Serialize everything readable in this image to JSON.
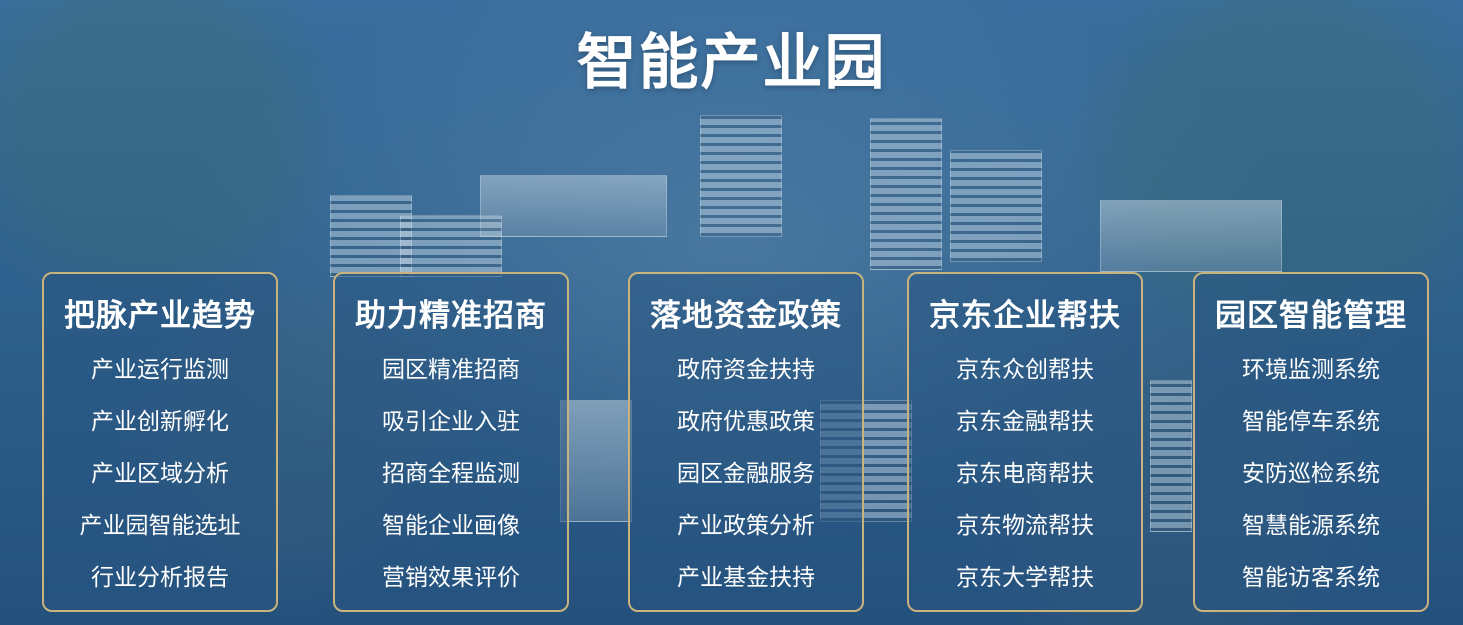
{
  "page": {
    "title": "智能产业园"
  },
  "theme": {
    "background": "#2f5f8f",
    "card_border": "#c9b27c",
    "text": "#ffffff"
  },
  "cards": [
    {
      "title": "把脉产业趋势",
      "items": [
        "产业运行监测",
        "产业创新孵化",
        "产业区域分析",
        "产业园智能选址",
        "行业分析报告"
      ]
    },
    {
      "title": "助力精准招商",
      "items": [
        "园区精准招商",
        "吸引企业入驻",
        "招商全程监测",
        "智能企业画像",
        "营销效果评价"
      ]
    },
    {
      "title": "落地资金政策",
      "items": [
        "政府资金扶持",
        "政府优惠政策",
        "园区金融服务",
        "产业政策分析",
        "产业基金扶持"
      ]
    },
    {
      "title": "京东企业帮扶",
      "items": [
        "京东众创帮扶",
        "京东金融帮扶",
        "京东电商帮扶",
        "京东物流帮扶",
        "京东大学帮扶"
      ]
    },
    {
      "title": "园区智能管理",
      "items": [
        "环境监测系统",
        "智能停车系统",
        "安防巡检系统",
        "智慧能源系统",
        "智能访客系统"
      ]
    }
  ]
}
